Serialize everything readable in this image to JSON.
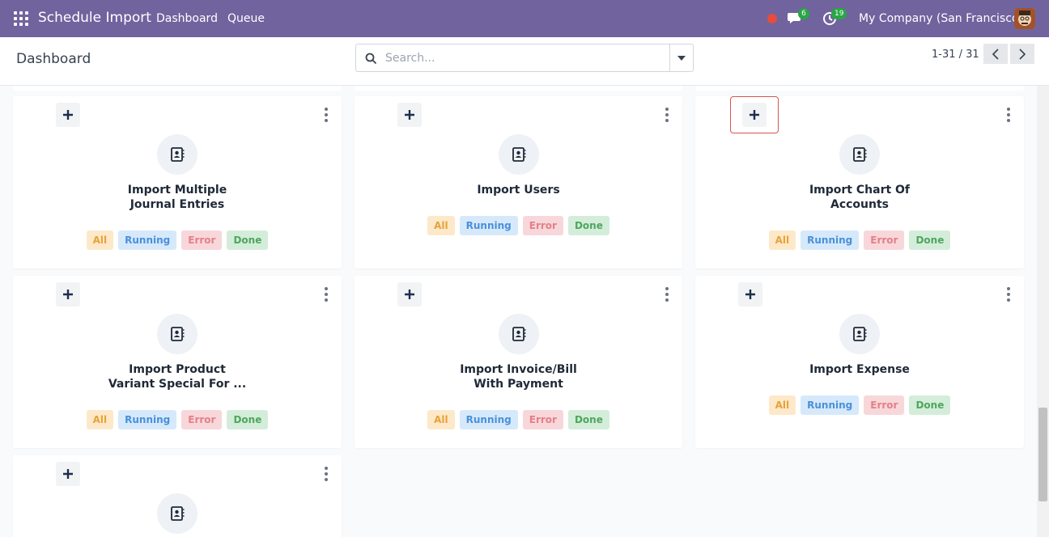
{
  "navbar": {
    "brand": "Schedule Import",
    "links": [
      "Dashboard",
      "Queue"
    ],
    "chat_count": "6",
    "activity_count": "19",
    "company": "My Company (San Francisco)",
    "color": "#71639e"
  },
  "control": {
    "title": "Dashboard",
    "search_placeholder": "Search...",
    "pager": "1-31 / 31"
  },
  "tags": {
    "all": "All",
    "running": "Running",
    "error": "Error",
    "done": "Done"
  },
  "cards": [
    {
      "title_line1": "Import Multiple",
      "title_line2": "Journal Entries"
    },
    {
      "title_line1": "Import Users",
      "title_line2": ""
    },
    {
      "title_line1": "Import Chart Of",
      "title_line2": "Accounts"
    },
    {
      "title_line1": "Import Product",
      "title_line2": "Variant Special For ..."
    },
    {
      "title_line1": "Import Invoice/Bill",
      "title_line2": "With Payment"
    },
    {
      "title_line1": "Import Expense",
      "title_line2": ""
    },
    {
      "title_line1": "",
      "title_line2": ""
    }
  ]
}
